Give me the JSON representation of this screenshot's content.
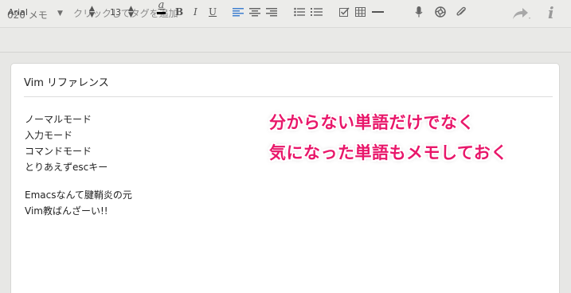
{
  "header": {
    "notebook_name": "020 メモ",
    "tag_placeholder": "クリックしてタグを追加"
  },
  "toolbar": {
    "font_family": "Arial",
    "font_size": "13",
    "bold_label": "B",
    "italic_label": "I",
    "underline_label": "U",
    "text_color_label": "a"
  },
  "note": {
    "title": "Vim リファレンス",
    "lines": [
      "ノーマルモード",
      "入力モード",
      "コマンドモード",
      "とりあえずescキー",
      "Emacsなんて腱鞘炎の元",
      "Vim教ばんざーい!!"
    ]
  },
  "annotation": {
    "line1": "分からない単語だけでなく",
    "line2": "気になった単語もメモしておく",
    "color": "#e8176a"
  }
}
